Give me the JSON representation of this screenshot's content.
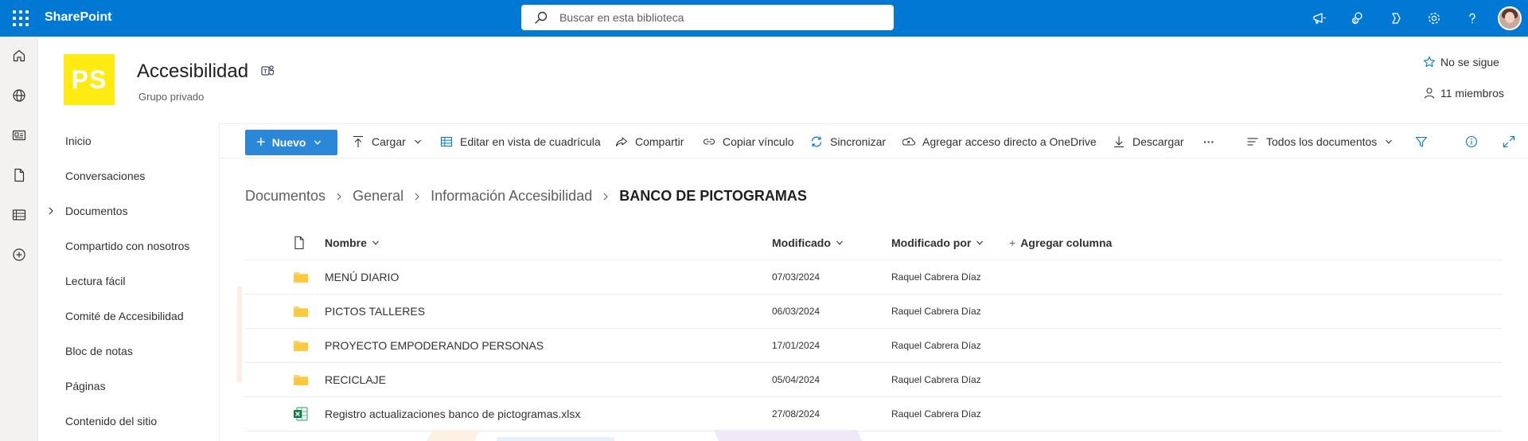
{
  "suite": {
    "brand": "SharePoint",
    "search_placeholder": "Buscar en esta biblioteca",
    "icons": [
      "megaphone-icon",
      "sharepoint-sites-icon",
      "copilot-icon",
      "settings-icon",
      "help-icon"
    ]
  },
  "rail": {
    "icons": [
      "home-icon",
      "globe-icon",
      "news-icon",
      "file-icon",
      "list-icon",
      "add-circle-icon"
    ]
  },
  "site": {
    "logo_text": "PS",
    "title": "Accesibilidad",
    "subtitle": "Grupo privado",
    "follow_label": "No se sigue",
    "members_label": "11 miembros",
    "logo_color": "#ffeb12"
  },
  "nav": {
    "items": [
      {
        "label": "Inicio"
      },
      {
        "label": "Conversaciones"
      },
      {
        "label": "Documentos"
      },
      {
        "label": "Compartido con nosotros"
      },
      {
        "label": "Lectura fácil"
      },
      {
        "label": "Comité de Accesibilidad"
      },
      {
        "label": "Bloc de notas"
      },
      {
        "label": "Páginas"
      },
      {
        "label": "Contenido del sitio"
      }
    ]
  },
  "commands": {
    "new": "Nuevo",
    "upload": "Cargar",
    "grid_edit": "Editar en vista de cuadrícula",
    "share": "Compartir",
    "copy_link": "Copiar vínculo",
    "sync": "Sincronizar",
    "add_shortcut": "Agregar acceso directo a OneDrive",
    "download": "Descargar",
    "more": "···",
    "view": "Todos los documentos",
    "accent": "#2b88d8"
  },
  "breadcrumb": [
    "Documentos",
    "General",
    "Información Accesibilidad",
    "BANCO DE PICTOGRAMAS"
  ],
  "list": {
    "columns": {
      "name": "Nombre",
      "modified": "Modificado",
      "modified_by": "Modificado por",
      "add_column": "Agregar columna"
    },
    "rows": [
      {
        "type": "folder",
        "name": "MENÚ DIARIO",
        "modified": "07/03/2024",
        "modified_by": "Raquel Cabrera Díaz"
      },
      {
        "type": "folder",
        "name": "PICTOS TALLERES",
        "modified": "06/03/2024",
        "modified_by": "Raquel Cabrera Díaz"
      },
      {
        "type": "folder",
        "name": "PROYECTO EMPODERANDO PERSONAS",
        "modified": "17/01/2024",
        "modified_by": "Raquel Cabrera Díaz"
      },
      {
        "type": "folder",
        "name": "RECICLAJE",
        "modified": "05/04/2024",
        "modified_by": "Raquel Cabrera Díaz"
      },
      {
        "type": "excel",
        "name": "Registro actualizaciones banco de pictogramas.xlsx",
        "modified": "27/08/2024",
        "modified_by": "Raquel Cabrera Díaz"
      }
    ]
  }
}
